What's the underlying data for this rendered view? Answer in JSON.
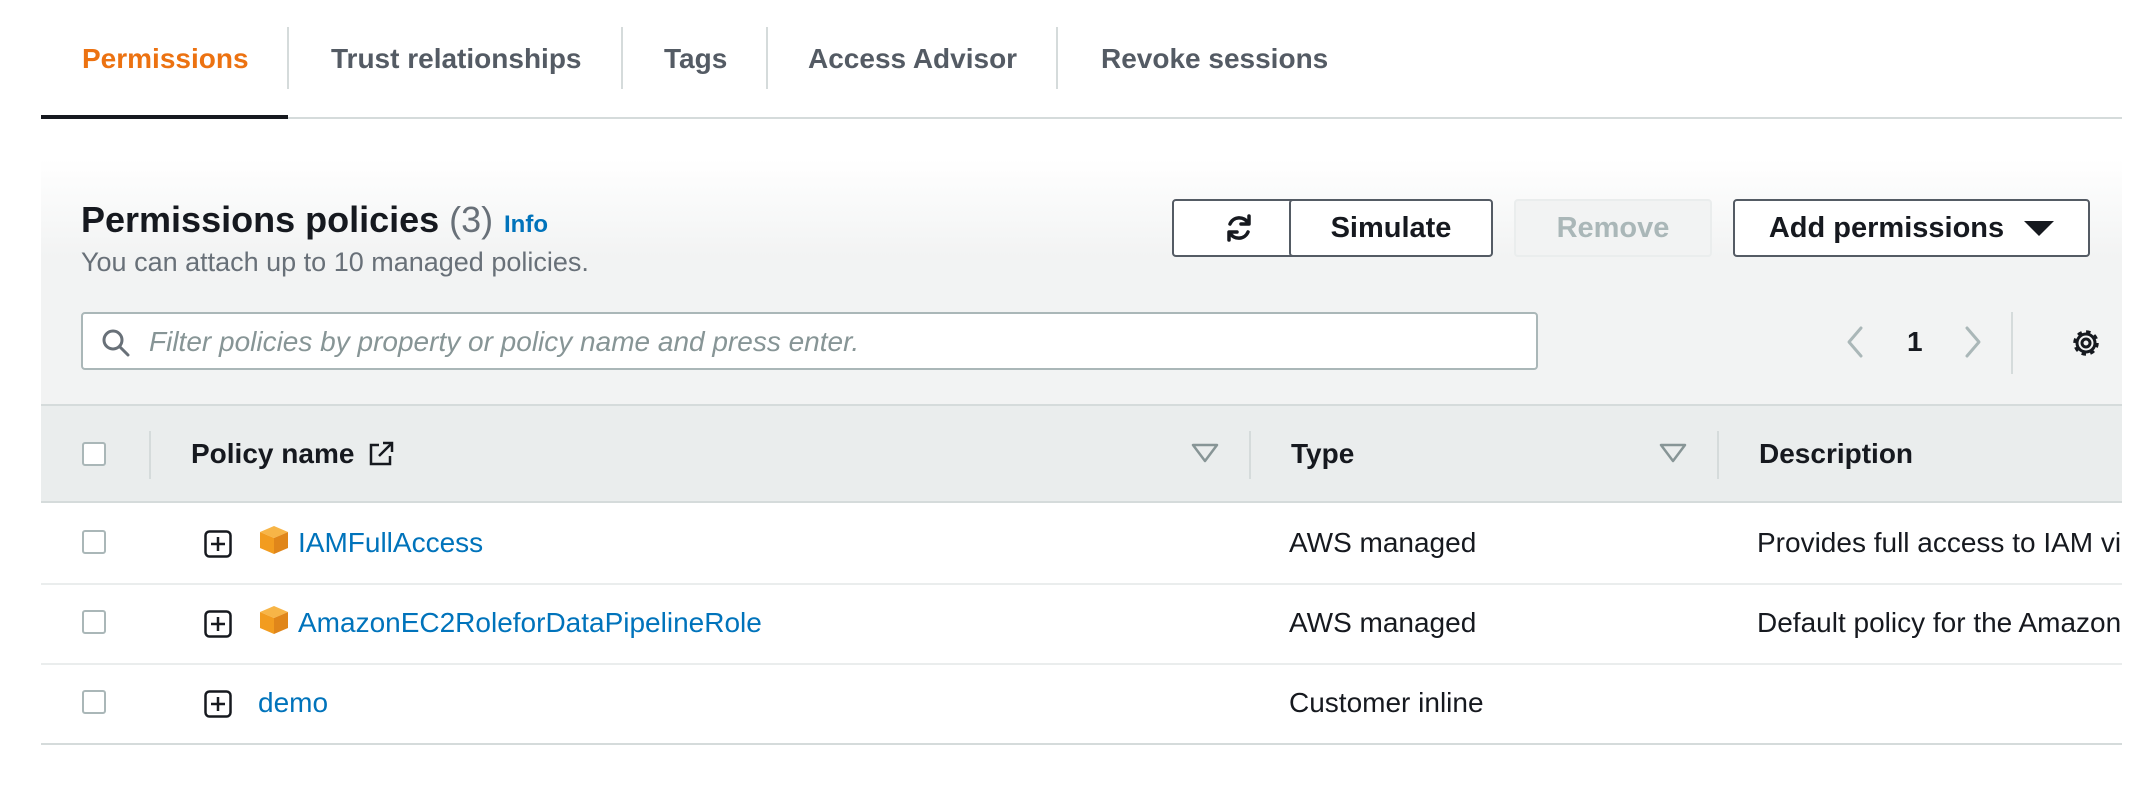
{
  "tabs": [
    {
      "label": "Permissions",
      "active": true
    },
    {
      "label": "Trust relationships"
    },
    {
      "label": "Tags"
    },
    {
      "label": "Access Advisor"
    },
    {
      "label": "Revoke sessions"
    }
  ],
  "colors": {
    "accent": "#ec7211",
    "link": "#0073bb",
    "text": "#16191f",
    "muted": "#687078"
  },
  "panel": {
    "title": "Permissions policies",
    "count": "(3)",
    "info_label": "Info",
    "subtitle": "You can attach up to 10 managed policies.",
    "buttons": {
      "refresh_icon": "refresh-icon",
      "simulate": "Simulate",
      "remove": "Remove",
      "add_permissions": "Add permissions"
    },
    "search": {
      "placeholder": "Filter policies by property or policy name and press enter.",
      "value": ""
    },
    "pagination": {
      "current_page": "1"
    }
  },
  "table": {
    "columns": {
      "policy_name": "Policy name",
      "type": "Type",
      "description": "Description"
    },
    "rows": [
      {
        "name": "IAMFullAccess",
        "type": "AWS managed",
        "description": "Provides full access to IAM vi",
        "managed_icon": true
      },
      {
        "name": "AmazonEC2RoleforDataPipelineRole",
        "type": "AWS managed",
        "description": "Default policy for the Amazon",
        "managed_icon": true
      },
      {
        "name": "demo",
        "type": "Customer inline",
        "description": "",
        "managed_icon": false
      }
    ]
  }
}
